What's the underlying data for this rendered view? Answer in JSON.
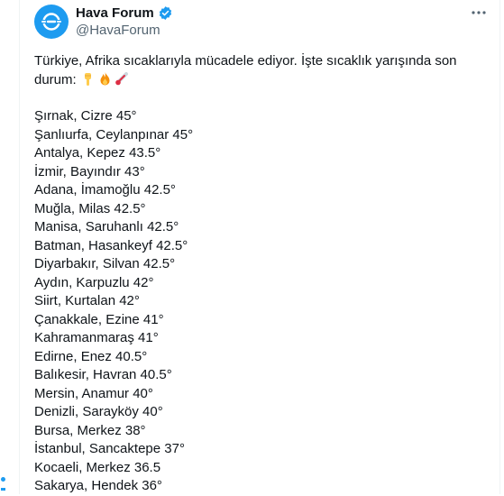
{
  "account": {
    "display_name": "Hava Forum",
    "handle": "@HavaForum",
    "verified": true,
    "avatar_icon": "cloud-link-icon",
    "brand_color": "#1d9bf0"
  },
  "more_icon": "more-horizontal-icon",
  "tweet": {
    "intro_line1": "Türkiye, Afrika sıcaklarıyla mücadele ediyor. İşte sıcaklık yarışında son",
    "intro_line2": "durum:",
    "emojis": [
      "pointing-down-emoji",
      "fire-emoji",
      "thermometer-emoji"
    ],
    "items": [
      "Şırnak, Cizre 45°",
      "Şanlıurfa, Ceylanpınar 45°",
      "Antalya, Kepez 43.5°",
      "İzmir, Bayındır 43°",
      "Adana, İmamoğlu 42.5°",
      "Muğla, Milas 42.5°",
      "Manisa, Saruhanlı 42.5°",
      "Batman, Hasankeyf 42.5°",
      "Diyarbakır, Silvan 42.5°",
      "Aydın, Karpuzlu 42°",
      "Siirt, Kurtalan 42°",
      "Çanakkale, Ezine 41°",
      "Kahramanmaraş 41°",
      "Edirne, Enez 40.5°",
      "Balıkesir, Havran 40.5°",
      "Mersin, Anamur 40°",
      "Denizli, Sarayköy 40°",
      "Bursa, Merkez 38°",
      "İstanbul, Sancaktepe 37°",
      "Kocaeli, Merkez 36.5",
      "Sakarya, Hendek 36°"
    ]
  }
}
